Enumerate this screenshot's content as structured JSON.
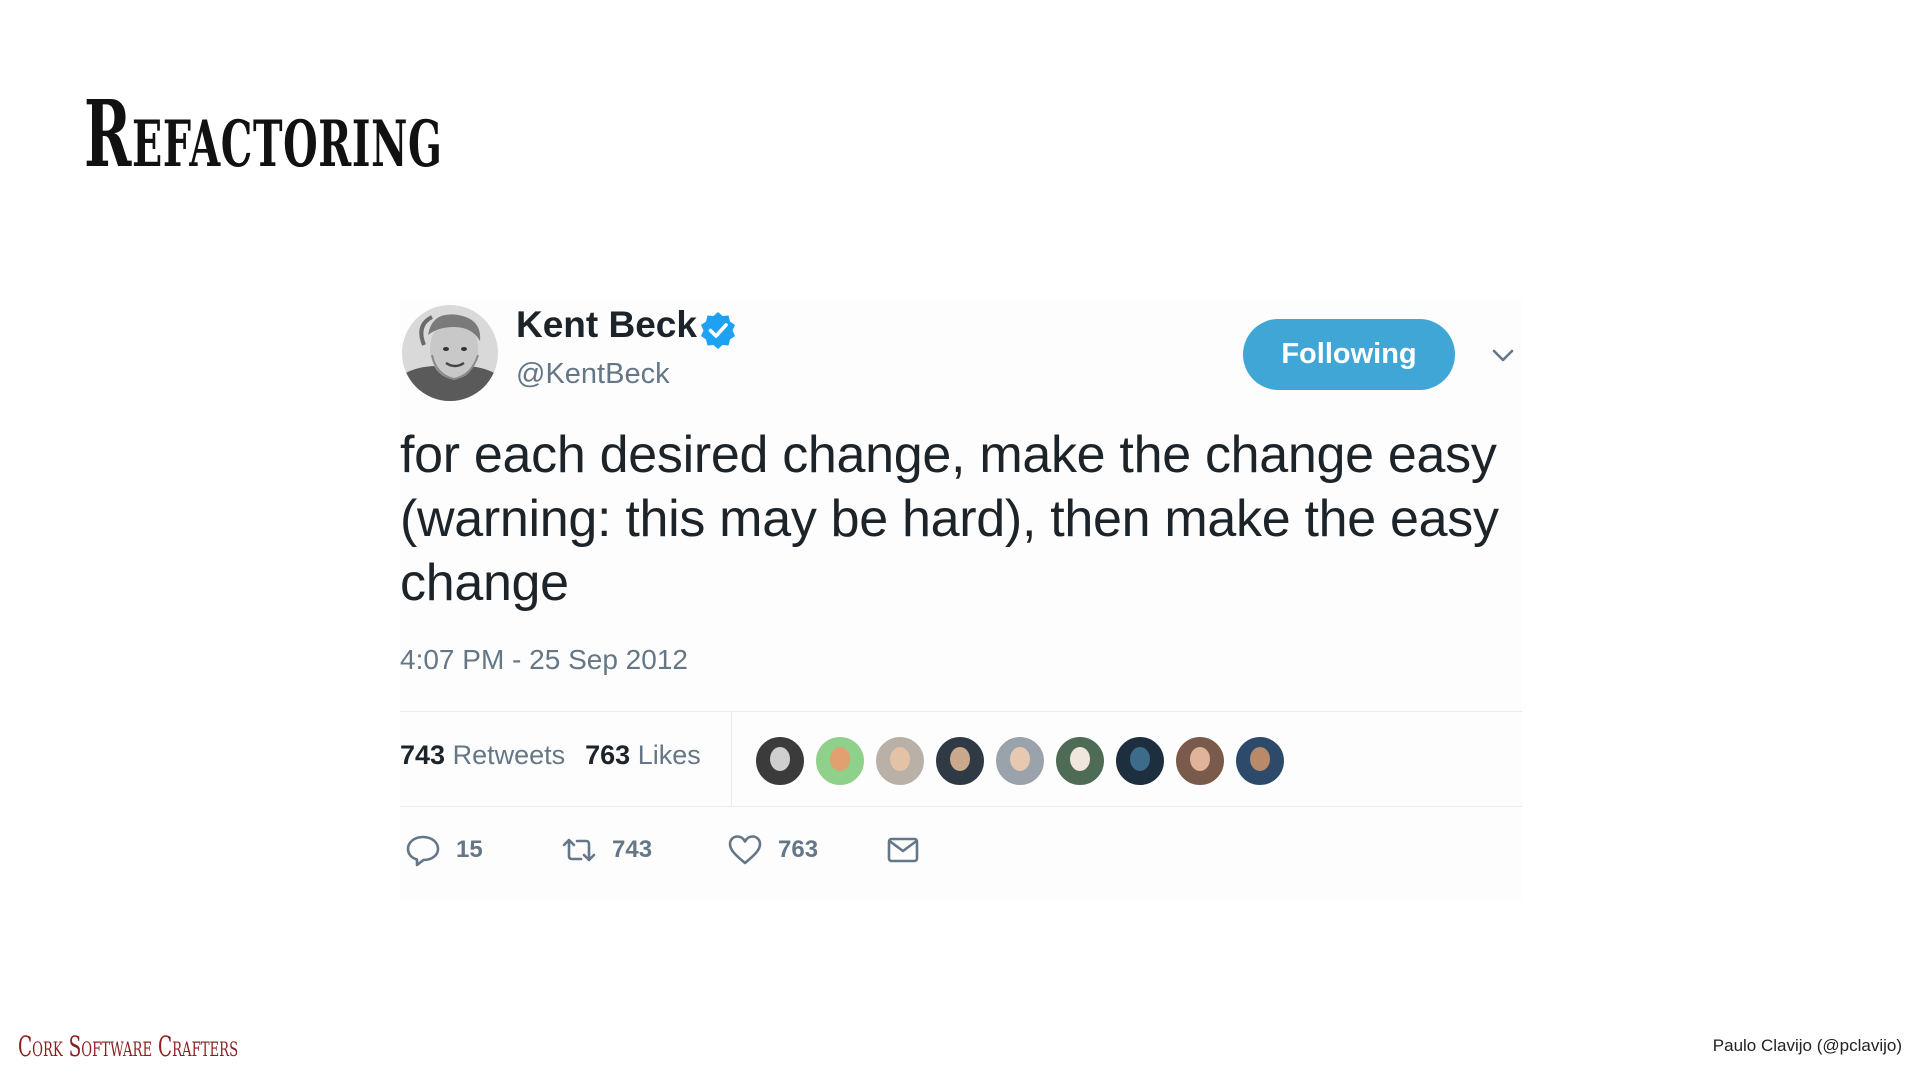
{
  "slide": {
    "title": "Refactoring",
    "footer_left": "Cork Software Crafters",
    "footer_right": "Paulo Clavijo (@pclavijo)"
  },
  "tweet": {
    "author_name": "Kent Beck",
    "author_handle": "@KentBeck",
    "verified": true,
    "follow_button_label": "Following",
    "text": "for each desired change, make the change easy (warning: this may be hard), then make the easy change",
    "timestamp": "4:07 PM - 25 Sep 2012",
    "stats": {
      "retweets_count": "743",
      "retweets_label": "Retweets",
      "likes_count": "763",
      "likes_label": "Likes"
    },
    "liker_avatar_count": 9,
    "actions": {
      "reply_count": "15",
      "retweet_count": "743",
      "like_count": "763"
    }
  },
  "colors": {
    "follow_button": "#3fa6d6",
    "verified_badge": "#1da1f2",
    "footer_brand": "#8b1f1f",
    "muted_text": "#657786",
    "main_text": "#1c2329"
  },
  "icons": {
    "verified": "verified-badge-icon",
    "menu": "chevron-down-icon",
    "reply": "reply-icon",
    "retweet": "retweet-icon",
    "like": "heart-icon",
    "message": "envelope-icon"
  }
}
